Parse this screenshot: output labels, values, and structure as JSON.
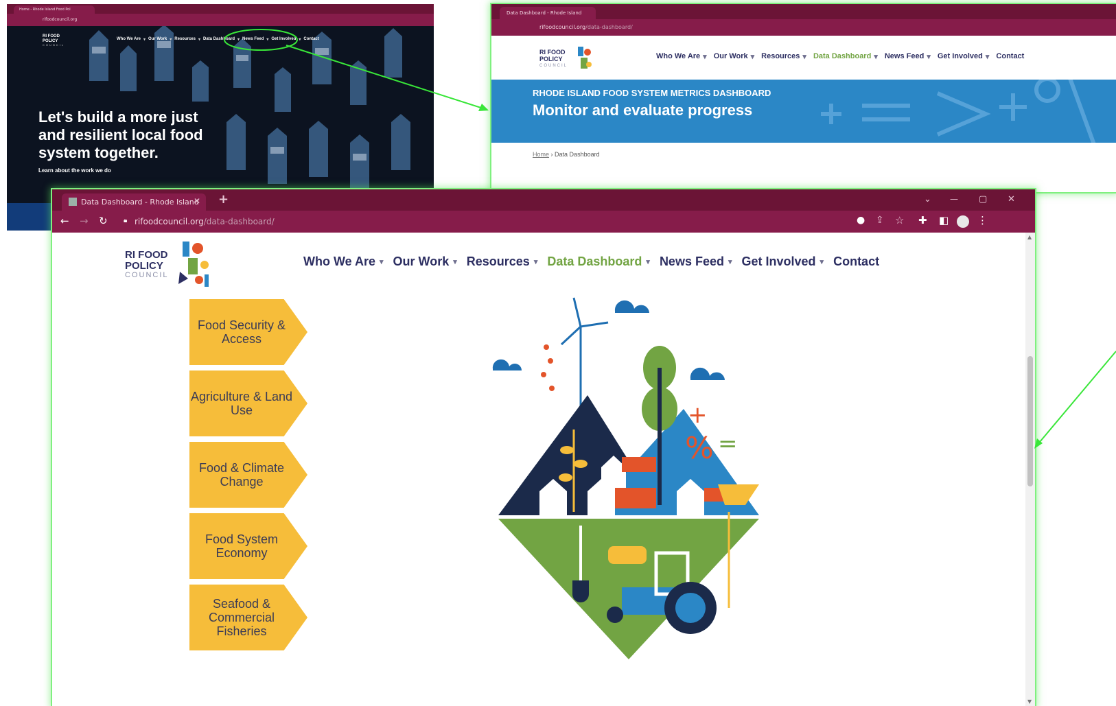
{
  "windows": {
    "home": {
      "tab_title": "Home - Rhode Island Food Pol",
      "url": "rifoodcouncil.org",
      "logo": [
        "RI FOOD",
        "POLICY",
        "COUNCIL"
      ],
      "nav": [
        "Who We Are",
        "Our Work",
        "Resources",
        "Data Dashboard",
        "News Feed",
        "Get Involved",
        "Contact"
      ],
      "hero_lines": [
        "Let's build a more just",
        "and resilient local food",
        "system together."
      ],
      "hero_link": "Learn about the work we do"
    },
    "dashboard_top": {
      "tab_title": "Data Dashboard - Rhode Island",
      "url_domain": "rifoodcouncil.org",
      "url_path": "/data-dashboard/",
      "logo": [
        "RI FOOD",
        "POLICY",
        "COUNCIL"
      ],
      "nav": [
        "Who We Are",
        "Our Work",
        "Resources",
        "Data Dashboard",
        "News Feed",
        "Get Involved",
        "Contact"
      ],
      "banner_kicker": "RHODE ISLAND FOOD SYSTEM METRICS DASHBOARD",
      "banner_title": "Monitor and evaluate progress",
      "breadcrumb_home": "Home",
      "breadcrumb_sep": "›",
      "breadcrumb_current": "Data Dashboard"
    },
    "main": {
      "tab_title": "Data Dashboard - Rhode Island",
      "tab_close": "✕",
      "new_tab": "+",
      "url_domain": "rifoodcouncil.org",
      "url_path": "/data-dashboard/",
      "window_controls": [
        "⌄",
        "—",
        "▢",
        "✕"
      ],
      "logo": [
        "RI FOOD",
        "POLICY",
        "COUNCIL"
      ],
      "nav": [
        "Who We Are",
        "Our Work",
        "Resources",
        "Data Dashboard",
        "News Feed",
        "Get Involved",
        "Contact"
      ],
      "active_nav": "Data Dashboard",
      "categories": [
        "Food Security & Access",
        "Agriculture & Land Use",
        "Food & Climate Change",
        "Food System Economy",
        "Seafood & Commercial Fisheries"
      ],
      "illustration_symbols": [
        "+",
        "%",
        "="
      ]
    }
  },
  "annotation": {
    "highlight_target": "Data Dashboard",
    "arrow_color": "#39e639",
    "glow_color": "#7ff07f"
  },
  "colors": {
    "browser_frame": "#6b1436",
    "toolbar": "#861c4a",
    "nav_text": "#2d2f62",
    "nav_active": "#72a443",
    "chevron": "#f6bd3a",
    "banner": "#2b87c6"
  }
}
